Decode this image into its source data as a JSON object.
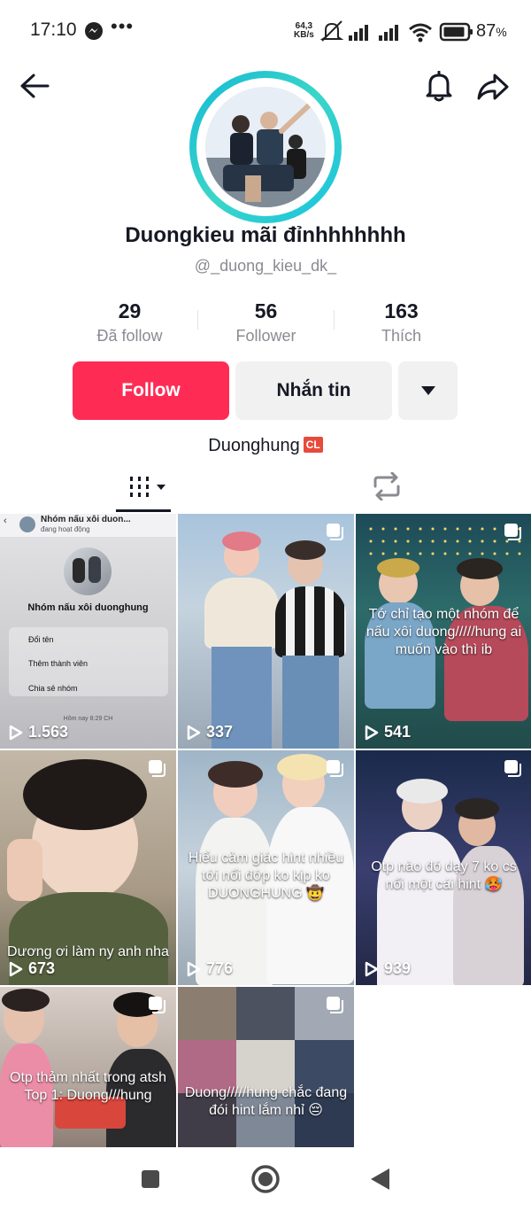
{
  "status_bar": {
    "time": "17:10",
    "more_dots": "•••",
    "net_speed_value": "64,3",
    "net_speed_unit": "KB/s",
    "battery": "87",
    "battery_unit": "%"
  },
  "profile": {
    "display_name": "Duongkieu mãi đỉnhhhhhhh",
    "username": "@_duong_kieu_dk_",
    "bio_text": "Duonghung",
    "bio_badge": "CL"
  },
  "stats": [
    {
      "value": "29",
      "label": "Đã follow"
    },
    {
      "value": "56",
      "label": "Follower"
    },
    {
      "value": "163",
      "label": "Thích"
    }
  ],
  "actions": {
    "follow_label": "Follow",
    "message_label": "Nhắn tin"
  },
  "videos": [
    {
      "views": "1.563",
      "caption": "",
      "screenshot": {
        "header_title": "Nhóm nấu xôi duon...",
        "header_sub": "đang hoạt động",
        "group_name": "Nhóm nấu xôi duonghung",
        "menu": [
          "Đổi tên",
          "Thêm thành viên",
          "Chia sẻ nhóm"
        ],
        "footer": "Hôm nay 8:29 CH"
      }
    },
    {
      "views": "337",
      "caption": ""
    },
    {
      "views": "541",
      "caption": "Tớ chỉ tạo một nhóm để nấu xôi duong/////hung ai muốn vào thì ib"
    },
    {
      "views": "673",
      "caption": "Dương ơi làm ny anh nha"
    },
    {
      "views": "776",
      "caption": "Hiểu cảm giác hint nhiều tới nổi đớp ko kịp ko DUONGHUNG 🤠"
    },
    {
      "views": "939",
      "caption": "Otp nào đó dạy 7 ko cs nổi một cái hint 🥵"
    },
    {
      "views": "",
      "caption": "Otp thảm nhất trong atsh\nTop 1: Duong///hung"
    },
    {
      "views": "",
      "caption": "Duong/////hung chắc đang đói hint lắm nhỉ 😔"
    }
  ],
  "icons": {
    "back": "arrow-left-icon",
    "bell": "bell-icon",
    "share": "share-icon",
    "dropdown": "caret-down-icon",
    "videos_tab": "grid-bars-icon",
    "reposts_tab": "repost-icon",
    "play": "play-icon",
    "multi": "multi-photo-icon"
  },
  "colors": {
    "follow": "#fe2c55",
    "secondary_button": "#f1f1f2",
    "muted_text": "#8a8b91",
    "avatar_ring": "#14b9d6",
    "bio_badge": "#e84a3b"
  }
}
